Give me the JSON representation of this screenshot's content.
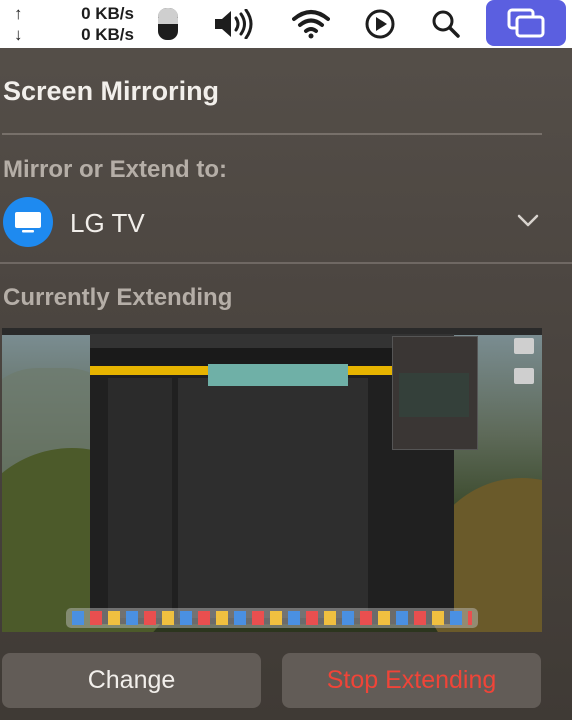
{
  "menubar": {
    "upload_arrow": "↑",
    "download_arrow": "↓",
    "upload_rate": "0 KB/s",
    "download_rate": "0 KB/s",
    "icons": [
      "mouse-battery-icon",
      "volume-icon",
      "wifi-icon",
      "play-icon",
      "search-icon",
      "screen-mirroring-icon"
    ],
    "active_color": "#5b5fe0"
  },
  "panel": {
    "title": "Screen Mirroring",
    "mirror_label": "Mirror or Extend to:",
    "device": {
      "name": "LG TV",
      "icon": "tv-icon",
      "icon_color": "#1e8af0"
    },
    "status_label": "Currently Extending"
  },
  "buttons": {
    "change": "Change",
    "stop": "Stop Extending",
    "stop_color": "#f04438"
  }
}
